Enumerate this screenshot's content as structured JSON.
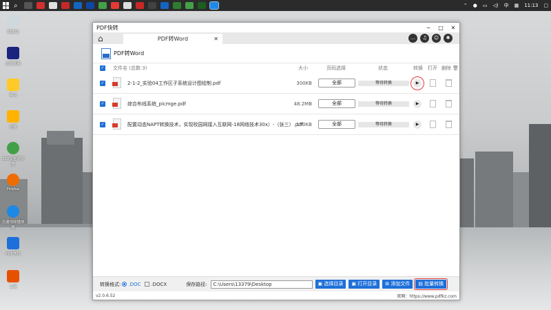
{
  "taskbar": {
    "time": "11:13",
    "ime": "中"
  },
  "desktop": {
    "icons": [
      {
        "label": "回收站"
      },
      {
        "label": "迅捷视频"
      },
      {
        "label": "学习"
      },
      {
        "label": "日报"
      },
      {
        "label": "360安全浏览器"
      },
      {
        "label": "Firefox"
      },
      {
        "label": "迅捷视频播放器"
      },
      {
        "label": "PDF快转"
      },
      {
        "label": "工具"
      }
    ]
  },
  "window": {
    "title": "PDF快转",
    "controls": {
      "minimize": "─",
      "maximize": "□",
      "close": "✕"
    }
  },
  "tabs": {
    "active": "PDF转Word",
    "close": "✕"
  },
  "toolhead": {
    "label": "PDF转Word"
  },
  "columns": {
    "filename": "文件名 (总数:3)",
    "size": "大小",
    "pages": "页码选择",
    "status": "状态",
    "convert": "转换",
    "open": "打开",
    "delete": "删除"
  },
  "files": [
    {
      "name": "2-1-2_实验04工作区子系统设计图绘制.pdf",
      "size": "300KB",
      "pages": "全部",
      "status": "等待转换"
    },
    {
      "name": "综合布线系统_picmge.pdf",
      "size": "48.2MB",
      "pages": "全部",
      "status": "等待转换"
    },
    {
      "name": "配置动态NAPT转换技术，实现校园网接入互联网-18网络技术30x）-（张三）.pdf",
      "size": "170KB",
      "pages": "全部",
      "status": "等待转换"
    }
  ],
  "bottom": {
    "format_label": "转换格式:",
    "format_doc": ".DOC",
    "format_docx": ".DOCX",
    "save_label": "保存路径:",
    "save_path": "C:\\Users\\13379\\Desktop",
    "choose_dir": "选择目录",
    "open_dir": "打开目录",
    "add_files": "添加文件",
    "batch_convert": "批量转换"
  },
  "statusline": {
    "version": "v2.0.6.52",
    "website": "官网：https://www.pdfkz.com"
  },
  "colors": {
    "accent": "#1e6fd9",
    "highlight": "#e53935"
  }
}
